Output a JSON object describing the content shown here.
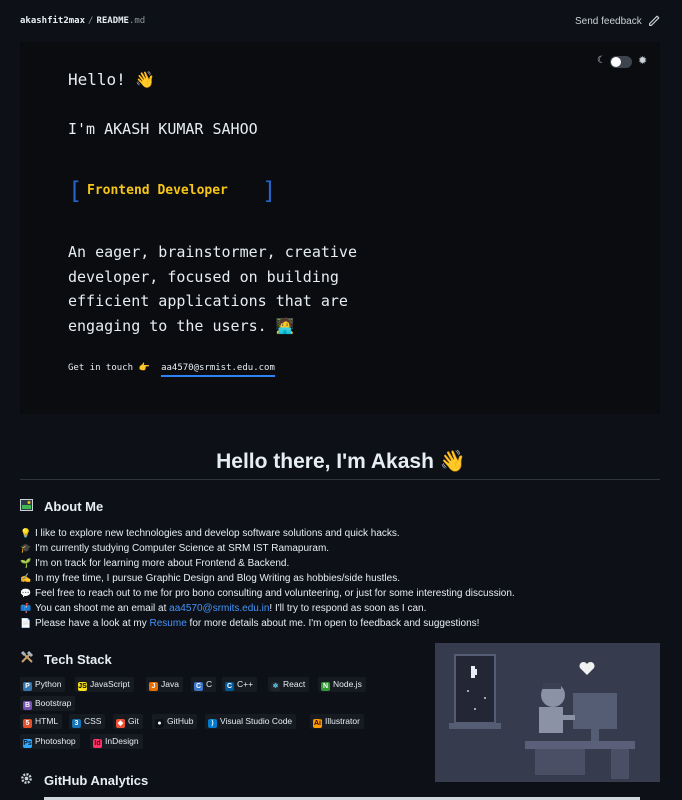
{
  "topbar": {
    "owner": "akashfit2max",
    "separator": "/",
    "file_name": "README",
    "file_ext": ".md",
    "feedback_label": "Send feedback"
  },
  "card": {
    "theme_moon": "☾",
    "theme_sun": "✹",
    "hello": "Hello! 👋",
    "intro": "I'm AKASH KUMAR SAHOO",
    "bracket_left": "[",
    "bracket_right": "]",
    "role": "Frontend Developer",
    "description": "An eager, brainstormer, creative developer, focused on building efficient applications that are engaging to the users. 🧑‍💻",
    "get_in_touch": "Get in touch 👉",
    "email": "aa4570@srmist.edu.com"
  },
  "heading": "Hello there, I'm Akash 👋",
  "about": {
    "title": "About Me",
    "items": [
      {
        "emoji": "💡",
        "text": "I like to explore new technologies and develop software solutions and quick hacks."
      },
      {
        "emoji": "🎓",
        "text": "I'm currently studying Computer Science at SRM IST Ramapuram."
      },
      {
        "emoji": "🌱",
        "text": "I'm on track for learning more about Frontend & Backend."
      },
      {
        "emoji": "✍",
        "text": "In my free time, I pursue Graphic Design and Blog Writing as hobbies/side hustles."
      },
      {
        "emoji": "💬",
        "text": "Feel free to reach out to me for pro bono consulting and volunteering, or just for some interesting discussion."
      },
      {
        "emoji": "📫",
        "pre": "You can shoot me an email at ",
        "link": "aa4570@srmits.edu.in",
        "post": "! I'll try to respond as soon as I can."
      },
      {
        "emoji": "📄",
        "pre": "Please have a look at my ",
        "link": "Resume",
        "post": " for more details about me. I'm open to feedback and suggestions!"
      }
    ]
  },
  "tech": {
    "title": "Tech Stack",
    "badges": [
      {
        "label": "Python",
        "color": "#3776ab",
        "glyph": "P"
      },
      {
        "label": "JavaScript",
        "color": "#f7df1e",
        "glyph": "JS"
      },
      {
        "label": "Java",
        "color": "#e76f00",
        "glyph": "J"
      },
      {
        "label": "C",
        "color": "#3c74c6",
        "glyph": "C"
      },
      {
        "label": "C++",
        "color": "#00599c",
        "glyph": "C"
      },
      {
        "label": "React",
        "color": "#61dafb",
        "glyph": "⚛"
      },
      {
        "label": "Node.js",
        "color": "#339933",
        "glyph": "N"
      },
      {
        "label": "Bootstrap",
        "color": "#7952b3",
        "glyph": "B"
      },
      {
        "label": "HTML",
        "color": "#e34f26",
        "glyph": "5"
      },
      {
        "label": "CSS",
        "color": "#1572b6",
        "glyph": "3"
      },
      {
        "label": "Git",
        "color": "#f05032",
        "glyph": "◆"
      },
      {
        "label": "GitHub",
        "color": "#ffffff",
        "glyph": "●"
      },
      {
        "label": "Visual Studio Code",
        "color": "#007acc",
        "glyph": "⟩"
      },
      {
        "label": "Illustrator",
        "color": "#ff9a00",
        "glyph": "Ai"
      },
      {
        "label": "Photoshop",
        "color": "#31a8ff",
        "glyph": "Ps"
      },
      {
        "label": "InDesign",
        "color": "#ff3366",
        "glyph": "Id"
      }
    ]
  },
  "analytics": {
    "title": "GitHub Analytics"
  }
}
